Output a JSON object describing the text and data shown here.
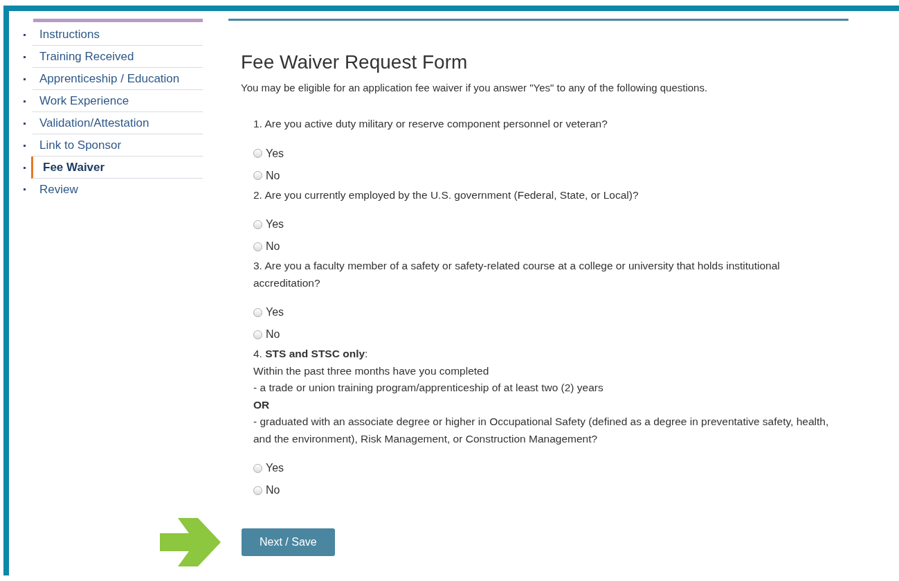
{
  "sidebar": {
    "items": [
      {
        "label": "Instructions",
        "selected": false
      },
      {
        "label": "Training Received",
        "selected": false
      },
      {
        "label": "Apprenticeship / Education",
        "selected": false
      },
      {
        "label": "Work Experience",
        "selected": false
      },
      {
        "label": "Validation/Attestation",
        "selected": false
      },
      {
        "label": "Link to Sponsor",
        "selected": false
      },
      {
        "label": "Fee Waiver",
        "selected": true
      },
      {
        "label": "Review",
        "selected": false
      }
    ]
  },
  "form": {
    "title": "Fee Waiver Request Form",
    "intro": "You may be eligible for an application fee waiver if you answer \"Yes\" to any of the following questions.",
    "questions": [
      {
        "lines": [
          {
            "kind": "text",
            "text": "1. Are you active duty military or reserve component personnel or veteran?"
          }
        ],
        "options": [
          {
            "label": "Yes",
            "selected": false
          },
          {
            "label": "No",
            "selected": false
          }
        ]
      },
      {
        "lines": [
          {
            "kind": "text",
            "text": "2. Are you currently employed by the U.S. government (Federal, State, or Local)?"
          }
        ],
        "options": [
          {
            "label": "Yes",
            "selected": false
          },
          {
            "label": "No",
            "selected": false
          }
        ]
      },
      {
        "lines": [
          {
            "kind": "text",
            "text": "3. Are you a faculty member of a safety or safety-related course at a college or university that holds institutional accreditation?"
          }
        ],
        "options": [
          {
            "label": "Yes",
            "selected": false
          },
          {
            "label": "No",
            "selected": false
          }
        ]
      },
      {
        "lines": [
          {
            "kind": "text",
            "text": "4. **STS and STSC only**:"
          },
          {
            "kind": "text",
            "text": "Within the past three months have you completed"
          },
          {
            "kind": "text",
            "text": "- a trade or union training program/apprenticeship of at least two (2) years"
          },
          {
            "kind": "bold",
            "text": "OR"
          },
          {
            "kind": "text",
            "text": "- graduated with an associate degree or higher in Occupational Safety (defined as a degree in preventative safety, health, and the environment), Risk Management, or Construction Management?"
          }
        ],
        "options": [
          {
            "label": "Yes",
            "selected": false
          },
          {
            "label": "No",
            "selected": false
          }
        ]
      }
    ],
    "submit": "Next / Save"
  }
}
